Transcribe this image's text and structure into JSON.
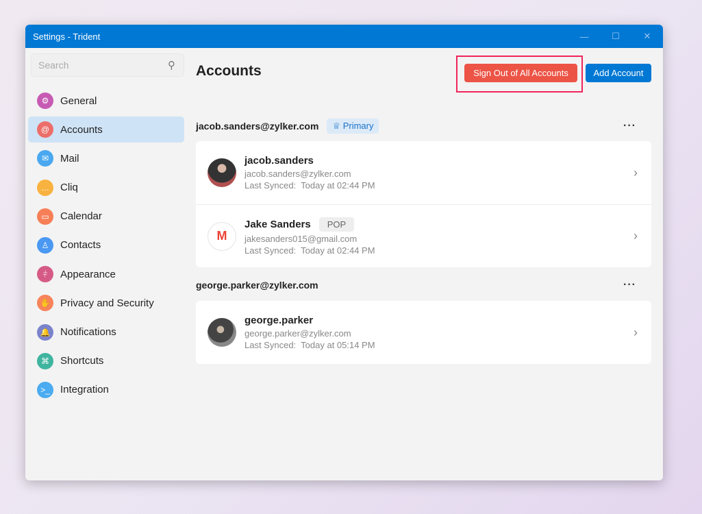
{
  "window": {
    "title": "Settings - Trident"
  },
  "sidebar": {
    "search_placeholder": "Search",
    "items": [
      {
        "label": "General",
        "color": "#c75bb4",
        "icon": "⚙"
      },
      {
        "label": "Accounts",
        "color": "#ec6e6a",
        "icon": "@"
      },
      {
        "label": "Mail",
        "color": "#4aa8f0",
        "icon": "✉"
      },
      {
        "label": "Cliq",
        "color": "#f8b23f",
        "icon": "…"
      },
      {
        "label": "Calendar",
        "color": "#f77f57",
        "icon": "▭"
      },
      {
        "label": "Contacts",
        "color": "#4a98f2",
        "icon": "♙"
      },
      {
        "label": "Appearance",
        "color": "#d65a86",
        "icon": "⫩"
      },
      {
        "label": "Privacy and Security",
        "color": "#f7845a",
        "icon": "✋"
      },
      {
        "label": "Notifications",
        "color": "#7b83cc",
        "icon": "🔔"
      },
      {
        "label": "Shortcuts",
        "color": "#3fb49f",
        "icon": "⌘"
      },
      {
        "label": "Integration",
        "color": "#4aabf0",
        "icon": ">_"
      }
    ]
  },
  "main": {
    "title": "Accounts",
    "sign_out_label": "Sign Out of All Accounts",
    "add_label": "Add Account",
    "groups": [
      {
        "email": "jacob.sanders@zylker.com",
        "badge": "Primary",
        "accounts": [
          {
            "name": "jacob.sanders",
            "email": "jacob.sanders@zylker.com",
            "synced_label": "Last Synced:",
            "synced": "Today at 02:44 PM"
          },
          {
            "name": "Jake Sanders",
            "tag": "POP",
            "email": "jakesanders015@gmail.com",
            "synced_label": "Last Synced:",
            "synced": "Today at 02:44 PM"
          }
        ]
      },
      {
        "email": "george.parker@zylker.com",
        "accounts": [
          {
            "name": "george.parker",
            "email": "george.parker@zylker.com",
            "synced_label": "Last Synced:",
            "synced": "Today at 05:14 PM"
          }
        ]
      }
    ]
  }
}
